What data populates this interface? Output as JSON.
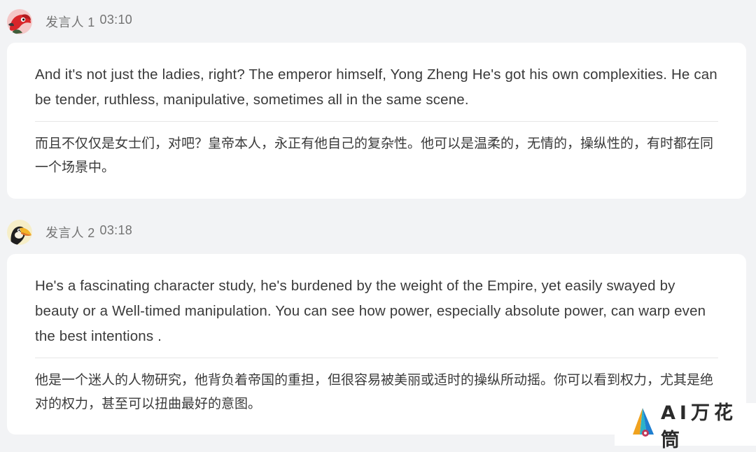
{
  "messages": [
    {
      "speaker": "发言人 1",
      "time": "03:10",
      "avatar_icon": "red-bird-avatar-icon",
      "english": "And it's not just the ladies, right? The emperor himself, Yong Zheng He's got his own complexities. He can be tender, ruthless, manipulative, sometimes all in the same scene.",
      "chinese": "而且不仅仅是女士们，对吧？皇帝本人，永正有他自己的复杂性。他可以是温柔的，无情的，操纵性的，有时都在同一个场景中。"
    },
    {
      "speaker": "发言人 2",
      "time": "03:18",
      "avatar_icon": "toucan-avatar-icon",
      "english": "He's a fascinating character study, he's burdened by the weight of the Empire, yet easily swayed by beauty or a Well-timed manipulation. You can see how power, especially absolute power, can warp even the best intentions .",
      "chinese": "他是一个迷人的人物研究，他背负着帝国的重担，但很容易被美丽或适时的操纵所动摇。你可以看到权力，尤其是绝对的权力，甚至可以扭曲最好的意图。"
    }
  ],
  "watermark": {
    "text": "AI万花筒",
    "icon": "triangle-logo-icon"
  },
  "colors": {
    "background": "#f2f3f5",
    "card": "#ffffff",
    "meta_text": "#737373",
    "body_text": "#3a3a3a"
  }
}
